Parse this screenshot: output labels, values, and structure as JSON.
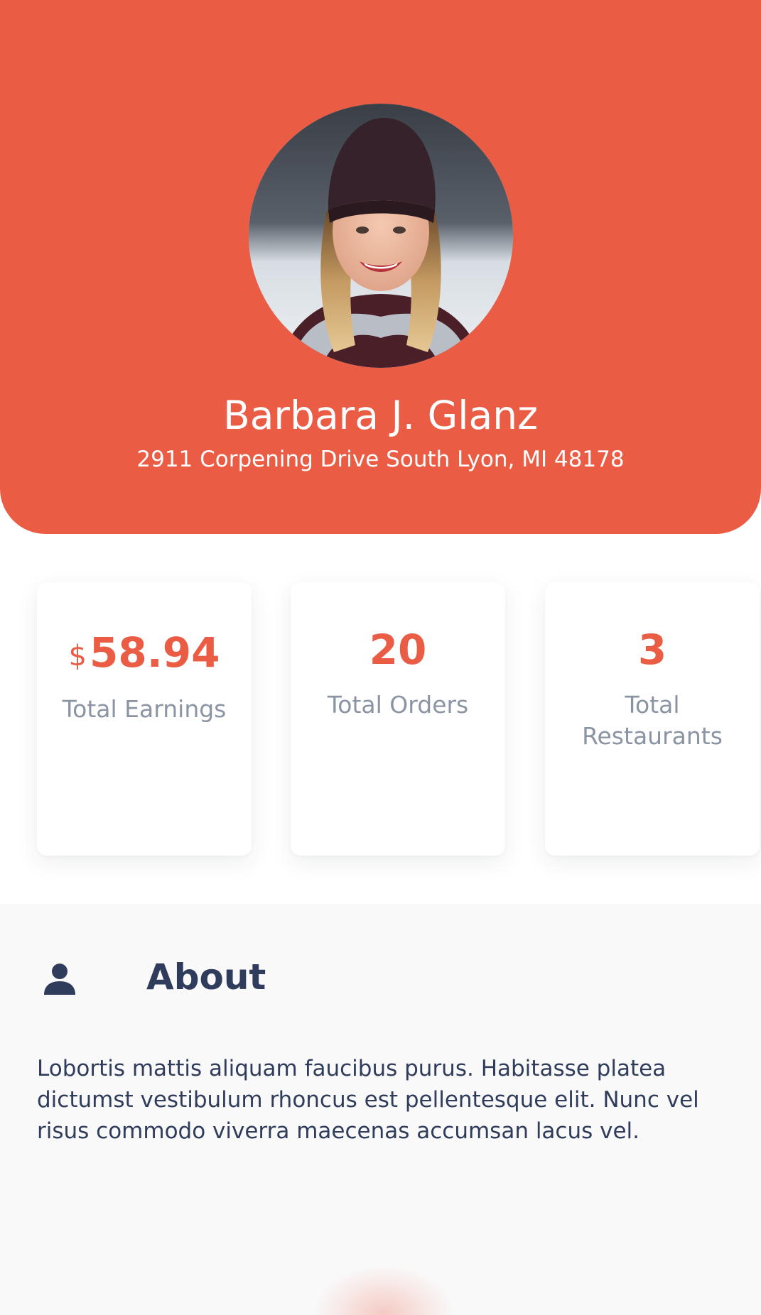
{
  "colors": {
    "accent": "#eb5c45",
    "text_dark": "#2f3c5b",
    "text_muted": "#8a94a3",
    "section_bg": "#f9f9f9"
  },
  "profile": {
    "name": "Barbara J. Glanz",
    "address": "2911 Corpening Drive South Lyon, MI 48178",
    "avatar_icon": "profile-photo"
  },
  "stats": [
    {
      "currency": "$",
      "value": "58.94",
      "label": "Total Earnings"
    },
    {
      "value": "20",
      "label": "Total Orders"
    },
    {
      "value": "3",
      "label": "Total Restaurants"
    }
  ],
  "about": {
    "icon": "user-icon",
    "title": "About",
    "text": "Lobortis mattis aliquam faucibus purus. Habitasse platea dictumst vestibulum rhoncus est pellentesque elit. Nunc vel risus commodo viverra maecenas accumsan lacus vel."
  }
}
